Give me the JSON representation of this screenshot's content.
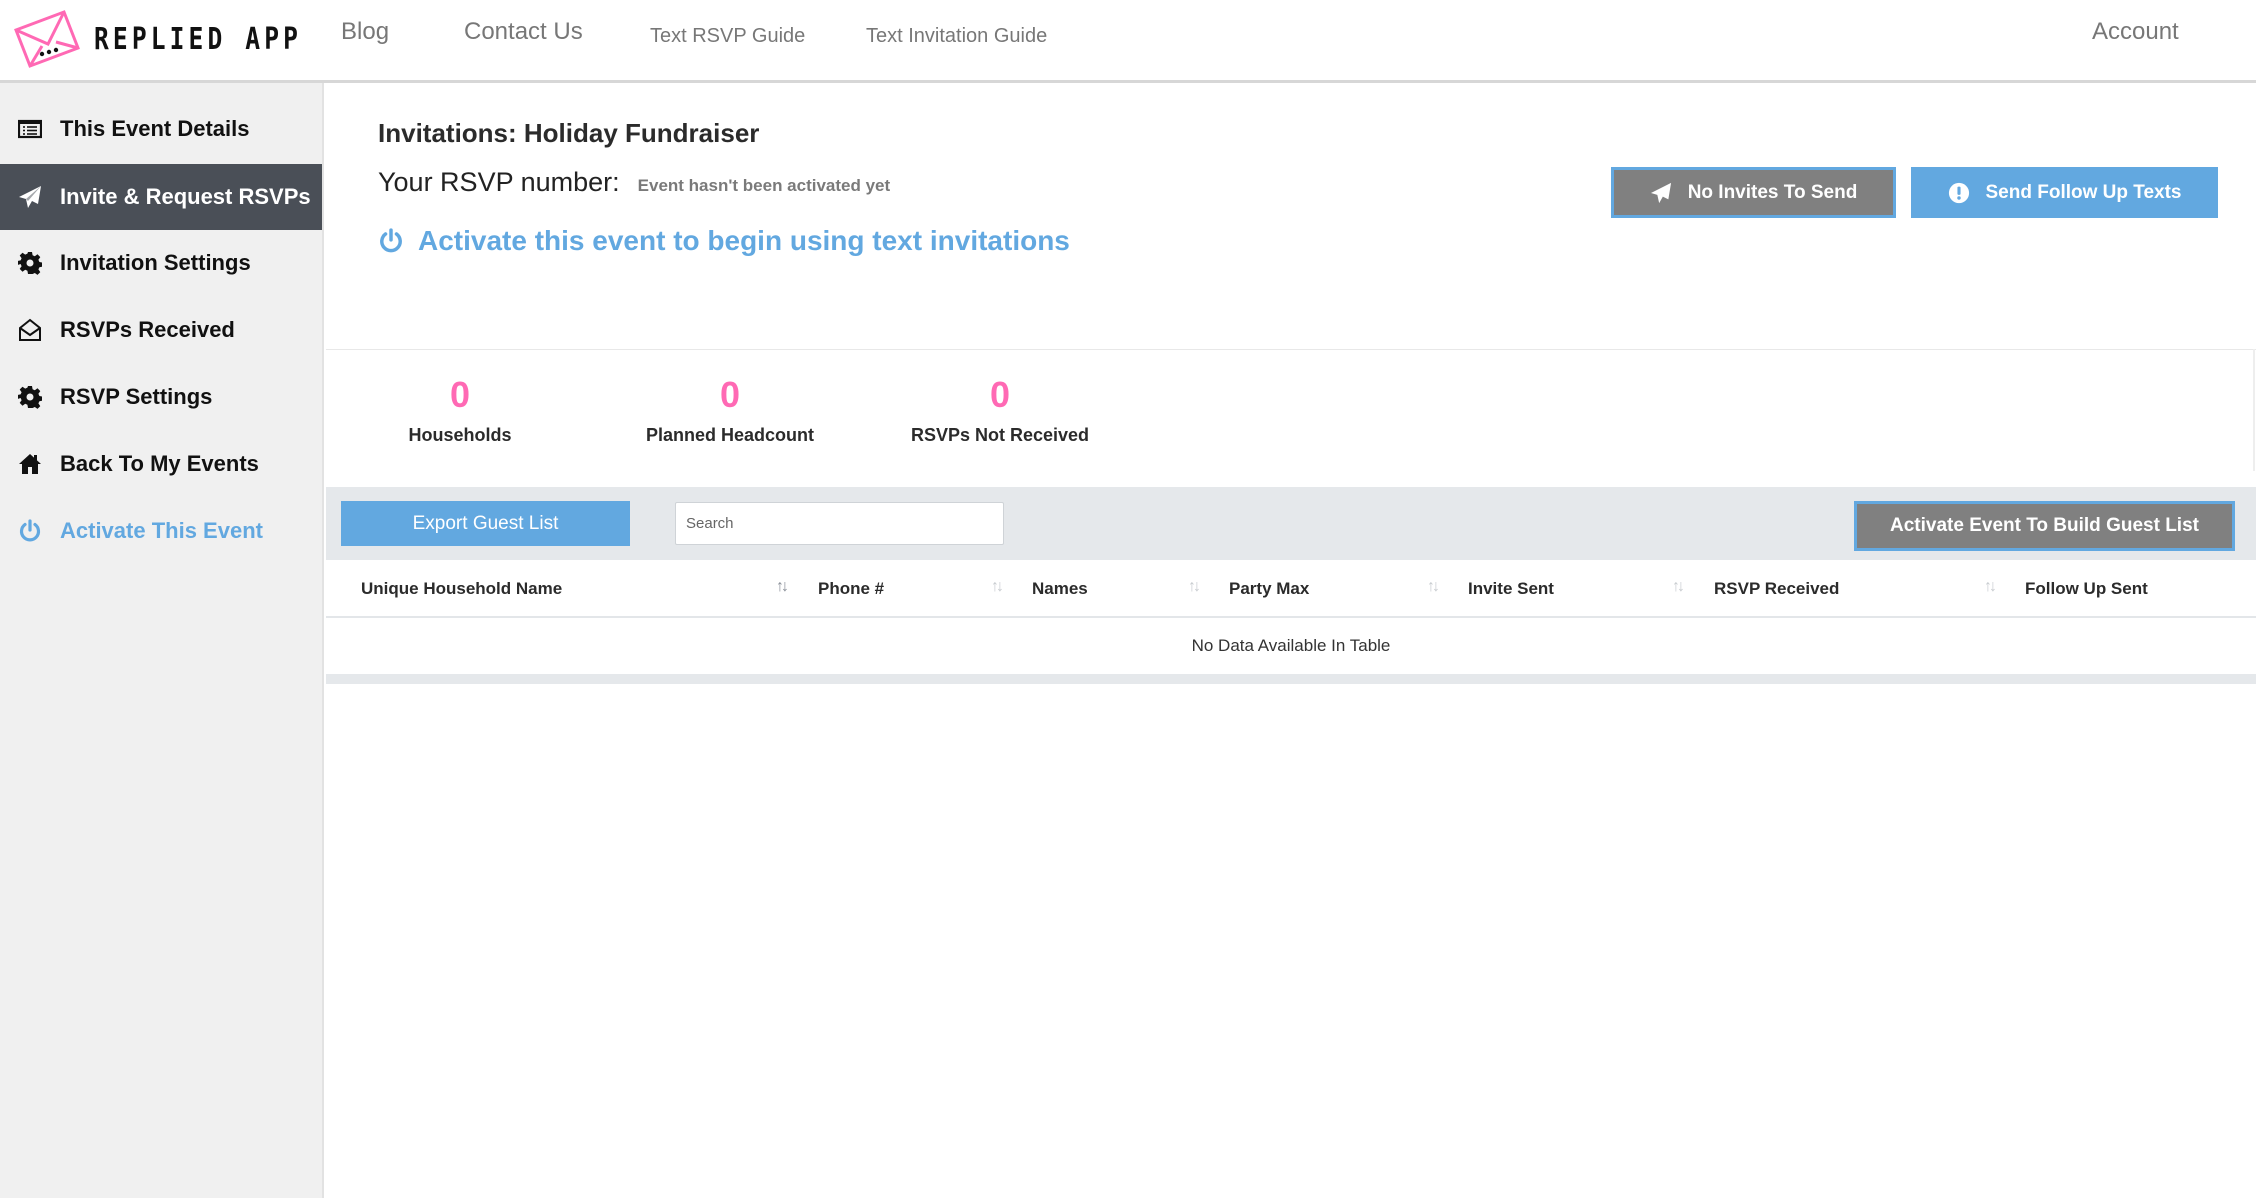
{
  "header": {
    "logo_text": "REPLIED APP",
    "nav": {
      "blog": "Blog",
      "contact": "Contact Us",
      "rsvp_guide": "Text RSVP Guide",
      "invitation_guide": "Text Invitation Guide",
      "account": "Account"
    }
  },
  "sidebar": {
    "items": [
      {
        "label": "This Event Details",
        "icon": "list-icon",
        "active": false
      },
      {
        "label": "Invite & Request RSVPs",
        "icon": "paper-plane-icon",
        "active": true
      },
      {
        "label": "Invitation Settings",
        "icon": "gear-icon",
        "active": false
      },
      {
        "label": "RSVPs Received",
        "icon": "envelope-open-icon",
        "active": false
      },
      {
        "label": "RSVP Settings",
        "icon": "gear-icon",
        "active": false
      },
      {
        "label": "Back To My Events",
        "icon": "home-icon",
        "active": false
      },
      {
        "label": "Activate This Event",
        "icon": "power-icon",
        "active": false
      }
    ]
  },
  "main": {
    "title": "Invitations: Holiday Fundraiser",
    "rsvp_number_label": "Your RSVP number:",
    "rsvp_number_status": "Event hasn't been activated yet",
    "activate_prompt": "Activate this event to begin using text invitations",
    "buttons": {
      "no_invites": "No Invites To Send",
      "follow_up": "Send Follow Up Texts",
      "export": "Export Guest List",
      "activate_guest_list": "Activate Event To Build Guest List"
    },
    "stats": [
      {
        "value": "0",
        "label": "Households"
      },
      {
        "value": "0",
        "label": "Planned Headcount"
      },
      {
        "value": "0",
        "label": "RSVPs Not Received"
      }
    ],
    "search": {
      "placeholder": "Search",
      "value": ""
    },
    "table": {
      "columns": [
        "Unique Household Name",
        "Phone #",
        "Names",
        "Party Max",
        "Invite Sent",
        "RSVP Received",
        "Follow Up Sent"
      ],
      "sort_icon": "↑↓",
      "empty_message": "No Data Available In Table",
      "rows": []
    }
  },
  "colors": {
    "accent_blue": "#62a8e0",
    "accent_pink": "#ff69b4",
    "sidebar_active": "#4a4f57",
    "disabled_gray": "#808080"
  }
}
